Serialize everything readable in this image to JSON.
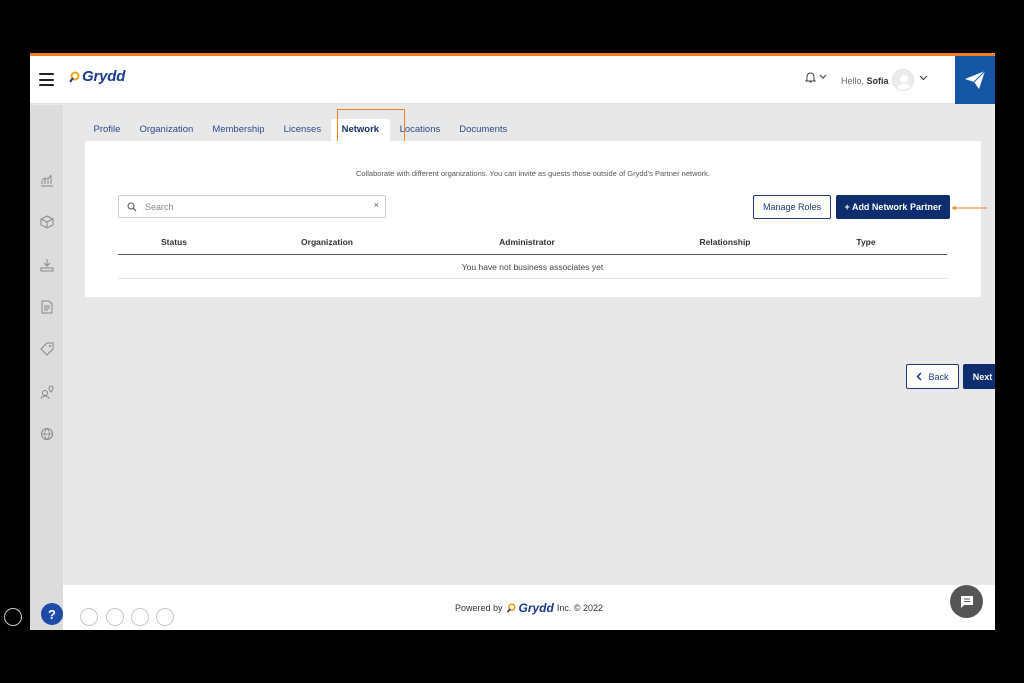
{
  "app": {
    "logo_text": "Grydd",
    "greeting": "Hello,",
    "user_name": "Sofia",
    "brand_color": "#0d2d6e",
    "accent_color": "#f08226"
  },
  "rail_icons": [
    "chart-icon",
    "box-icon",
    "download-icon",
    "document-icon",
    "tag-icon",
    "user-location-icon",
    "globe-settings-icon"
  ],
  "tabs": [
    {
      "label": "Profile"
    },
    {
      "label": "Organization"
    },
    {
      "label": "Membership"
    },
    {
      "label": "Licenses"
    },
    {
      "label": "Network",
      "active": true
    },
    {
      "label": "Locations"
    },
    {
      "label": "Documents"
    }
  ],
  "network": {
    "description": "Collaborate with different organizations. You can invite as guests those outside of Grydd's Partner network.",
    "search_placeholder": "Search",
    "manage_roles_label": "Manage Roles",
    "add_partner_label": "+ Add Network Partner",
    "columns": [
      "Status",
      "Organization",
      "Administrator",
      "Relationship",
      "Type"
    ],
    "empty_message": "You have not business associates yet"
  },
  "nav": {
    "back_label": "Back",
    "next_label": "Next"
  },
  "footer": {
    "powered_prefix": "Powered by",
    "brand": "Grydd",
    "suffix": "Inc. © 2022"
  },
  "help_label": "?"
}
